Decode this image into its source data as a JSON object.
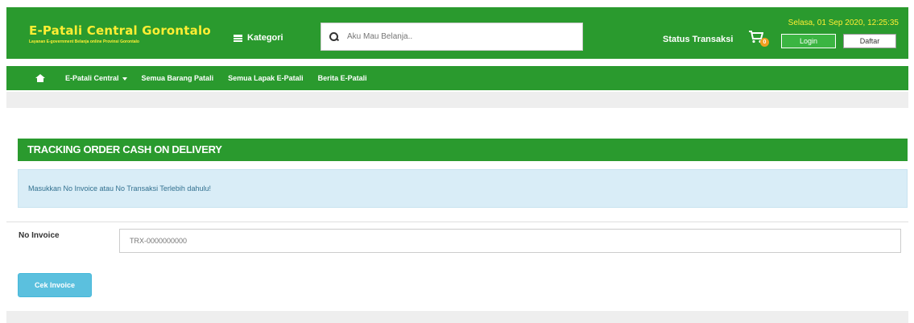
{
  "header": {
    "brand_title": "E-Patali Central Gorontalo",
    "brand_subtitle": "Layanan E-government Belanja online Provinsi Gorontalo",
    "kategori_label": "Kategori",
    "search_placeholder": "Aku Mau Belanja..",
    "status_transaksi": "Status Transaksi",
    "cart_count": "0",
    "datetime": "Selasa, 01 Sep 2020, 12:25:35",
    "login_label": "Login",
    "daftar_label": "Daftar"
  },
  "nav": {
    "items": [
      {
        "label": "E-Patali Central"
      },
      {
        "label": "Semua Barang Patali"
      },
      {
        "label": "Semua Lapak E-Patali"
      },
      {
        "label": "Berita E-Patali"
      }
    ]
  },
  "main": {
    "panel_title": "TRACKING ORDER CASH ON DELIVERY",
    "alert_text": "Masukkan No Invoice atau No Transaksi Terlebih dahulu!",
    "invoice_label": "No Invoice",
    "invoice_placeholder": "TRX-0000000000",
    "cek_button": "Cek Invoice"
  },
  "colors": {
    "brand_green": "#2a9a2e",
    "brand_yellow": "#ffee33",
    "alert_bg": "#d9edf7",
    "button_info": "#5bc0de"
  }
}
